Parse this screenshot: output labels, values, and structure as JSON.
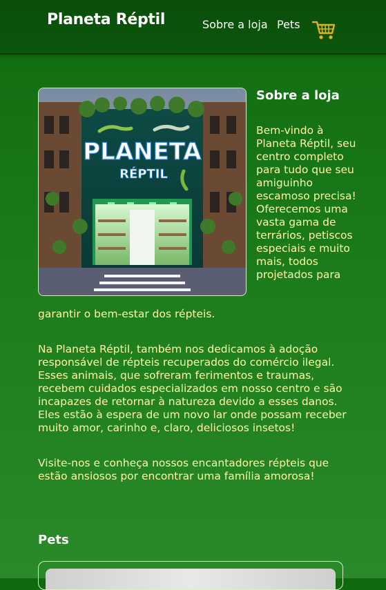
{
  "header": {
    "brand": "Planeta Réptil",
    "nav": {
      "about": "Sobre a loja",
      "pets": "Pets"
    },
    "cart_icon": "cart-icon"
  },
  "hero": {
    "sign_line1": "PLANETA",
    "sign_line2": "RÉPTIL"
  },
  "about": {
    "title": "Sobre a loja",
    "p1_side": "Bem-vindo à Planeta Réptil, seu centro completo para tudo que seu amiguinho escamoso precisa! Oferecemos uma vasta gama de terrários, petiscos especiais e muito mais, todos projetados para",
    "p1_tail": "garantir o bem-estar dos répteis.",
    "p2": "Na Planeta Réptil, também nos dedicamos à adoção responsável de répteis recuperados do comércio ilegal. Esses animais, que sofreram ferimentos e traumas, recebem cuidados especializados em nosso centro e são incapazes de retornar à natureza devido a esses danos. Eles estão à espera de um novo lar onde possam receber muito amor, carinho e, claro, deliciosos insetos!",
    "p3": "Visite-nos e conheça nossos encantadores répteis que estão ansiosos por encontrar uma família amorosa!"
  },
  "pets": {
    "title": "Pets"
  },
  "colors": {
    "header_bg": "#0c560c",
    "body_bg": "#1a7a1a",
    "text_yellow": "#fff7a8",
    "cart_gold": "#e0b020"
  }
}
